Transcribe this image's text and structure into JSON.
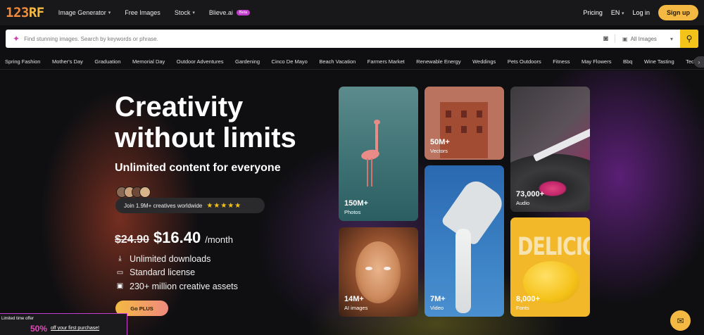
{
  "logo": {
    "text_a": "123",
    "text_b": "RF"
  },
  "nav": {
    "image_generator": "Image Generator",
    "free_images": "Free Images",
    "stock": "Stock",
    "blieve": "Blieve.ai",
    "beta": "Beta",
    "pricing": "Pricing",
    "lang": "EN",
    "login": "Log in",
    "signup": "Sign up"
  },
  "search": {
    "placeholder": "Find stunning images. Search by keywords or phrase.",
    "type_selected": "All Images"
  },
  "categories": [
    "Spring Fashion",
    "Mother's Day",
    "Graduation",
    "Memorial Day",
    "Outdoor Adventures",
    "Gardening",
    "Cinco De Mayo",
    "Beach Vacation",
    "Farmers Market",
    "Renewable Energy",
    "Weddings",
    "Pets Outdoors",
    "Fitness",
    "May Flowers",
    "Bbq",
    "Wine Tasting",
    "Tech Inno"
  ],
  "hero": {
    "headline_line1": "Creativity",
    "headline_line2": "without limits",
    "subhead": "Unlimited content for everyone",
    "social": "Join 1.9M+ creatives worldwide",
    "stars": "★★★★★",
    "old_price": "$24.90",
    "new_price": "$16.40",
    "per": "/month",
    "features": [
      "Unlimited downloads",
      "Standard license",
      "230+ million creative assets"
    ],
    "cta": "Go PLUS"
  },
  "tiles": {
    "photos": {
      "count": "150M+",
      "name": "Photos"
    },
    "vectors": {
      "count": "50M+",
      "name": "Vectors"
    },
    "audio": {
      "count": "73,000+",
      "name": "Audio"
    },
    "ai": {
      "count": "14M+",
      "name": "AI images"
    },
    "video": {
      "count": "7M+",
      "name": "Video"
    },
    "fonts": {
      "count": "8,000+",
      "name": "Fonts",
      "sample": "DELICIOUS"
    }
  },
  "offer": {
    "tag": "Limited time offer",
    "big": "50%",
    "small": "off your first purchase!"
  },
  "colors": {
    "accent": "#f4b942",
    "brand_pink": "#c43ecf",
    "search_button": "#f4c31a"
  }
}
